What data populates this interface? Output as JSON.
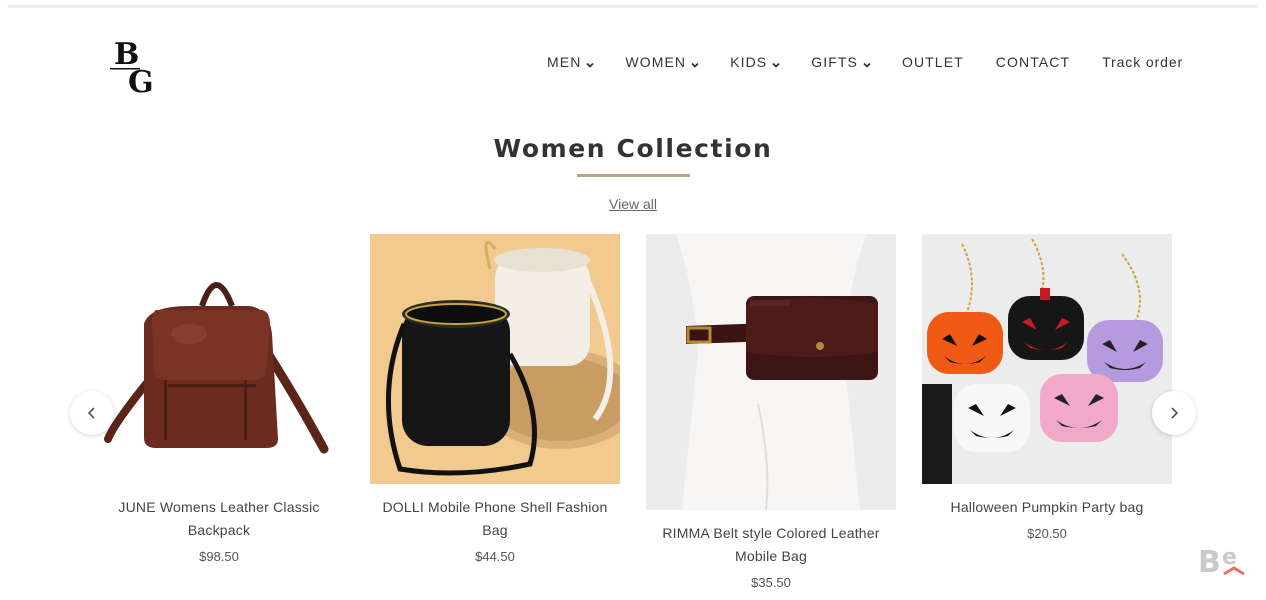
{
  "brand": {
    "logo_icon": "bg-monogram-icon"
  },
  "nav": {
    "items": [
      {
        "label": "MEN",
        "dropdown": true
      },
      {
        "label": "WOMEN",
        "dropdown": true
      },
      {
        "label": "KIDS",
        "dropdown": true
      },
      {
        "label": "GIFTS",
        "dropdown": true
      },
      {
        "label": "OUTLET",
        "dropdown": false
      },
      {
        "label": "CONTACT",
        "dropdown": false
      },
      {
        "label": "Track order",
        "dropdown": false
      }
    ]
  },
  "section": {
    "title": "Women Collection",
    "view_all": "View all",
    "accent_color": "#b7a48a"
  },
  "products": [
    {
      "name": "JUNE Womens Leather Classic Backpack",
      "price": "$98.50",
      "image_icon": "leather-backpack-image"
    },
    {
      "name": "DOLLI Mobile Phone Shell Fashion Bag",
      "price": "$44.50",
      "image_icon": "bucket-bag-image"
    },
    {
      "name": "RIMMA Belt style Colored Leather Mobile Bag",
      "price": "$35.50",
      "image_icon": "belt-bag-image"
    },
    {
      "name": "Halloween Pumpkin Party bag",
      "price": "$20.50",
      "image_icon": "pumpkin-bags-image"
    }
  ],
  "carousel": {
    "prev_icon": "chevron-left-icon",
    "next_icon": "chevron-right-icon"
  },
  "watermark": {
    "icon": "behance-logo-icon"
  }
}
